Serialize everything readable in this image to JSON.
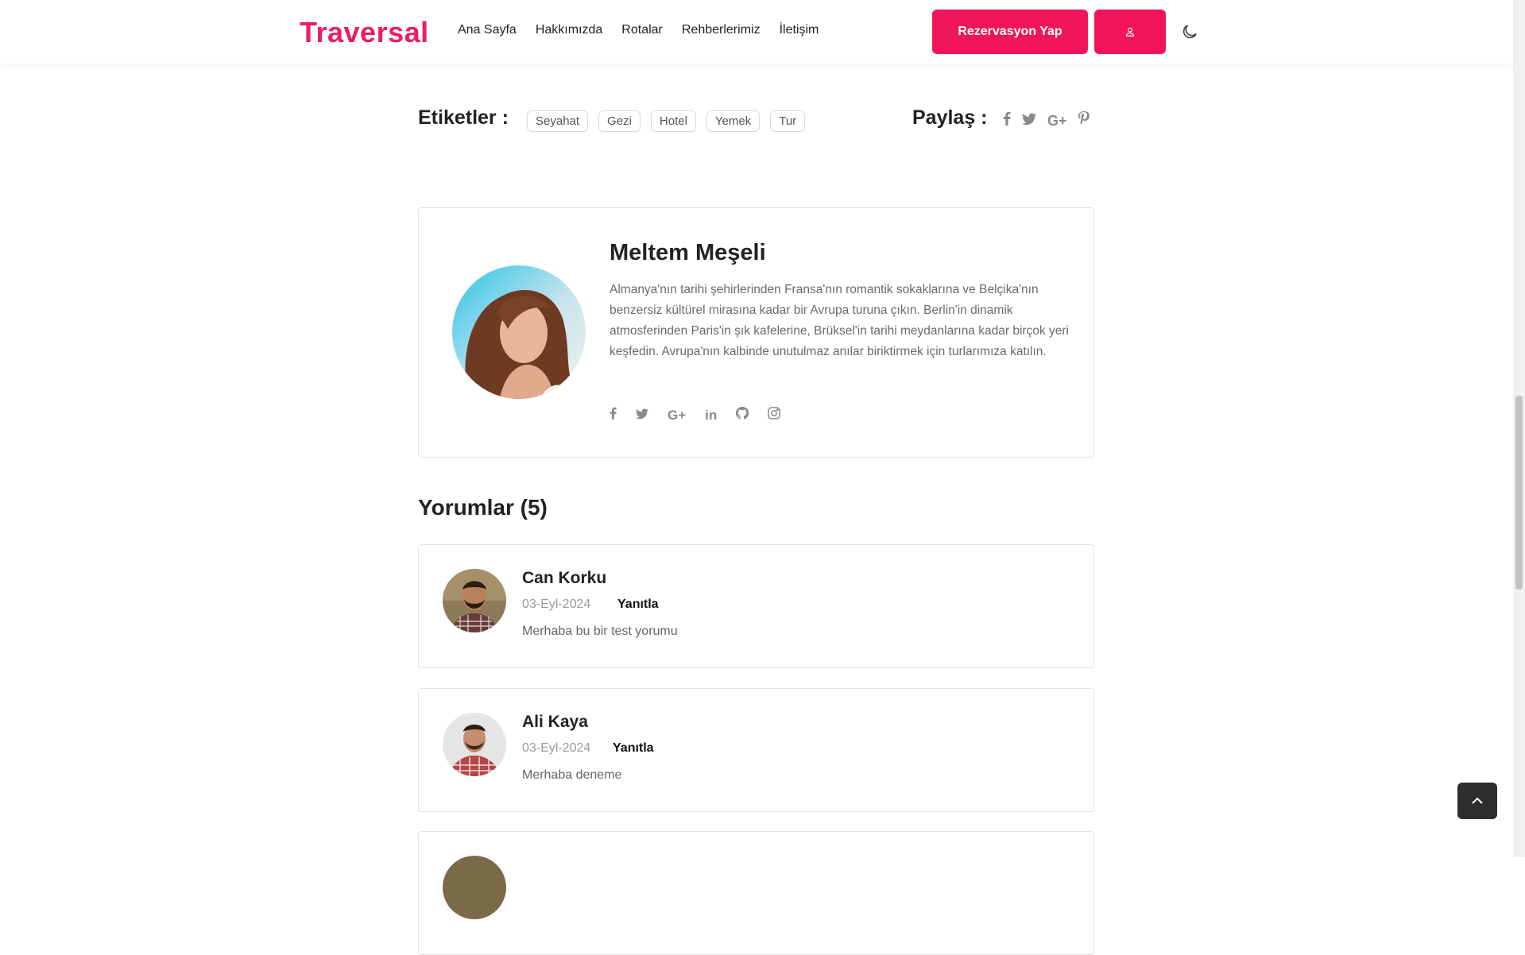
{
  "nav": {
    "logo": "Traversal",
    "links": [
      "Ana Sayfa",
      "Hakkımızda",
      "Rotalar",
      "Rehberlerimiz",
      "İletişim"
    ],
    "reserve_label": "Rezervasyon Yap",
    "accent": "#f0155b"
  },
  "tags": {
    "title": "Etiketler :",
    "items": [
      "Seyahat",
      "Gezi",
      "Hotel",
      "Yemek",
      "Tur"
    ]
  },
  "share": {
    "title": "Paylaş :",
    "icons": [
      "facebook-icon",
      "twitter-icon",
      "google-plus-icon",
      "pinterest-icon"
    ]
  },
  "author": {
    "name": "Meltem Meşeli",
    "bio": "Almanya'nın tarihi şehirlerinden Fransa'nın romantik sokaklarına ve Belçika'nın benzersiz kültürel mirasına kadar bir Avrupa turuna çıkın. Berlin'in dinamik atmosferinden Paris'in şık kafelerine, Brüksel'in tarihi meydanlarına kadar birçok yeri keşfedin. Avrupa'nın kalbinde unutulmaz anılar biriktirmek için turlarımıza katılın.",
    "social": [
      "facebook-icon",
      "twitter-icon",
      "google-plus-icon",
      "linkedin-icon",
      "github-icon",
      "instagram-icon"
    ]
  },
  "comments": {
    "title": "Yorumlar (5)",
    "items": [
      {
        "name": "Can Korku",
        "date": "03-Eyl-2024",
        "reply": "Yanıtla",
        "text": "Merhaba bu bir test yorumu"
      },
      {
        "name": "Ali Kaya",
        "date": "03-Eyl-2024",
        "reply": "Yanıtla",
        "text": "Merhaba deneme"
      }
    ]
  }
}
